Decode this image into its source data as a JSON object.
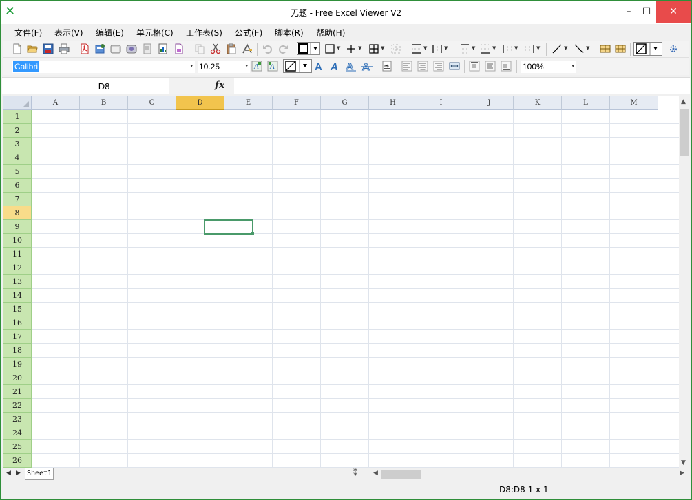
{
  "window": {
    "title": "无题 - Free Excel Viewer V2",
    "logo_icon": "x-logo-icon",
    "controls": {
      "minimize": "–",
      "maximize": "☐",
      "close": "✕"
    }
  },
  "menu": [
    {
      "label": "文件(F)"
    },
    {
      "label": "表示(V)"
    },
    {
      "label": "编辑(E)"
    },
    {
      "label": "单元格(C)"
    },
    {
      "label": "工作表(S)"
    },
    {
      "label": "公式(F)"
    },
    {
      "label": "脚本(R)"
    },
    {
      "label": "帮助(H)"
    }
  ],
  "toolbar1": {
    "icons": [
      "new-file-icon",
      "open-folder-icon",
      "save-icon",
      "print-icon",
      "pdf-icon",
      "export-icon",
      "image-icon",
      "picture-icon",
      "page-setup-icon",
      "chart-icon",
      "clear-icon",
      "copy-icon",
      "cut-icon",
      "paste-icon",
      "format-painter-icon",
      "undo-icon",
      "redo-icon",
      "border-box-icon",
      "border-outer-icon",
      "border-inner-icon",
      "border-all-icon",
      "border-none-icon",
      "border-top-icon",
      "border-vertical-icon",
      "border-horizontal-icon",
      "border-bottom-icon",
      "border-left-icon",
      "border-right-icon",
      "diagonal-up-icon",
      "diagonal-down-icon",
      "merge-cells-icon",
      "unmerge-cells-icon",
      "fill-color-icon",
      "settings-icon"
    ]
  },
  "toolbar2": {
    "font_name": "Calibri",
    "font_size": "10.25",
    "zoom": "100%",
    "arrow": "▾"
  },
  "formula_bar": {
    "name_box": "D8",
    "fx_label": "fx",
    "formula": ""
  },
  "grid": {
    "columns": [
      "A",
      "B",
      "C",
      "D",
      "E",
      "F",
      "G",
      "H",
      "I",
      "J",
      "K",
      "L",
      "M"
    ],
    "rows": [
      "1",
      "2",
      "3",
      "4",
      "5",
      "6",
      "7",
      "8",
      "9",
      "10",
      "11",
      "12",
      "13",
      "14",
      "15",
      "16",
      "17",
      "18",
      "19",
      "20",
      "21",
      "22",
      "23",
      "24",
      "25",
      "26"
    ],
    "active_column": "D",
    "active_row": "8"
  },
  "sheets": {
    "tabs": [
      "Sheet1"
    ],
    "prev": "◀",
    "next": "▶",
    "split": "⁑"
  },
  "status": {
    "selection": "D8:D8 1 x 1"
  },
  "colors": {
    "accent": "#217346",
    "row_header": "#c8e6b0",
    "active_header": "#f2c44d",
    "close_button": "#e84b4b"
  }
}
